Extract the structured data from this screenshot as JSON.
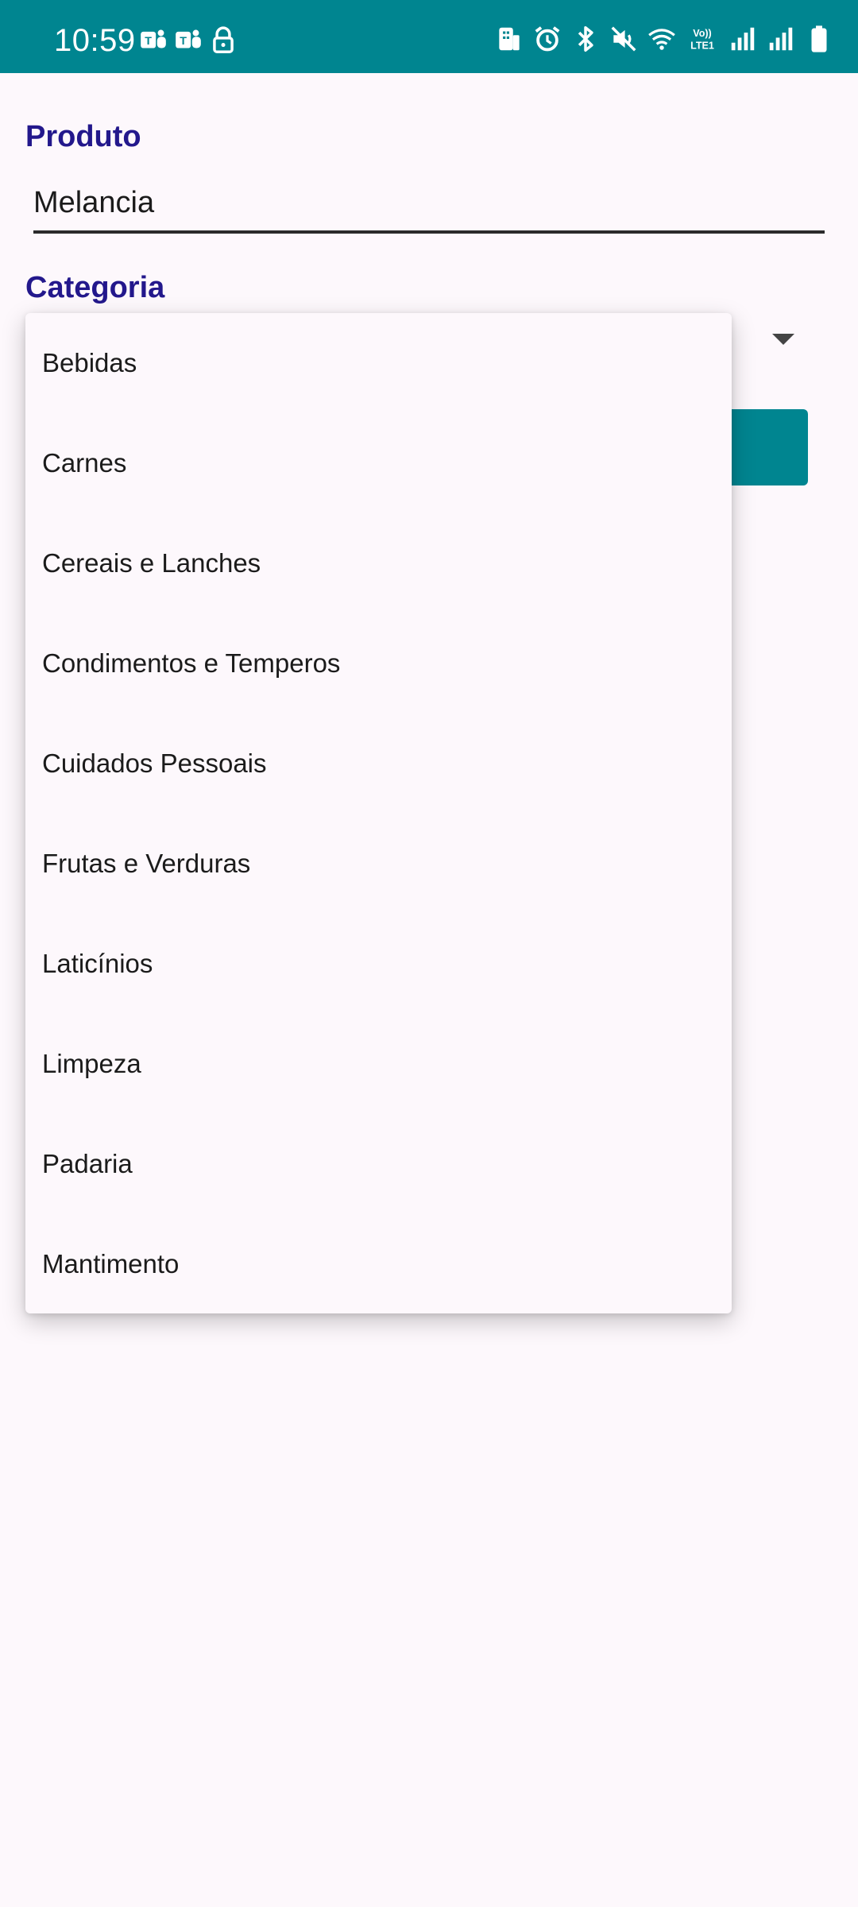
{
  "status_bar": {
    "time": "10:59",
    "background": "#008590",
    "left_icons": [
      "teams-icon",
      "teams-icon",
      "lock-icon"
    ],
    "right_icons": [
      "building-icon",
      "alarm-icon",
      "bluetooth-icon",
      "mute-icon",
      "wifi-icon",
      "volte-icon",
      "signal-icon",
      "signal-icon",
      "battery-icon"
    ],
    "volte_text": "Vo)) LTE1"
  },
  "form": {
    "product_label": "Produto",
    "product_value": "Melancia",
    "category_label": "Categoria"
  },
  "dropdown": {
    "items": [
      "Bebidas",
      "Carnes",
      "Cereais e Lanches",
      "Condimentos e Temperos",
      "Cuidados Pessoais",
      "Frutas e Verduras",
      "Laticínios",
      "Limpeza",
      "Padaria",
      "Mantimento"
    ]
  },
  "colors": {
    "accent": "#008590",
    "label": "#23188c",
    "background": "#fdf8fc"
  }
}
